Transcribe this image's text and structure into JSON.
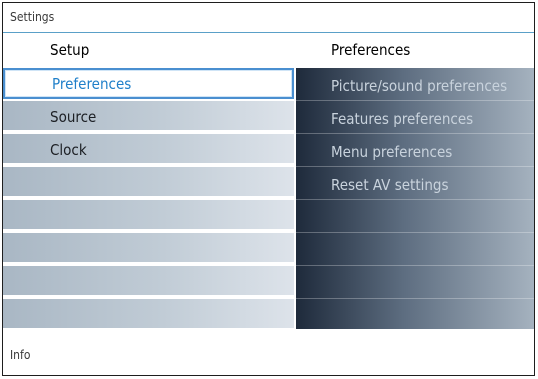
{
  "window": {
    "title": "Settings"
  },
  "left_panel": {
    "header": "Setup",
    "items": [
      {
        "label": "Preferences",
        "selected": true
      },
      {
        "label": "Source",
        "selected": false
      },
      {
        "label": "Clock",
        "selected": false
      }
    ]
  },
  "right_panel": {
    "header": "Preferences",
    "items": [
      {
        "label": "Picture/sound preferences"
      },
      {
        "label": "Features preferences"
      },
      {
        "label": "Menu preferences"
      },
      {
        "label": "Reset AV settings"
      }
    ]
  },
  "footer": {
    "info": "Info"
  },
  "colors": {
    "accent": "#4a8fd0",
    "selected_text": "#1f7fc9",
    "divider": "#5aa0c8"
  }
}
